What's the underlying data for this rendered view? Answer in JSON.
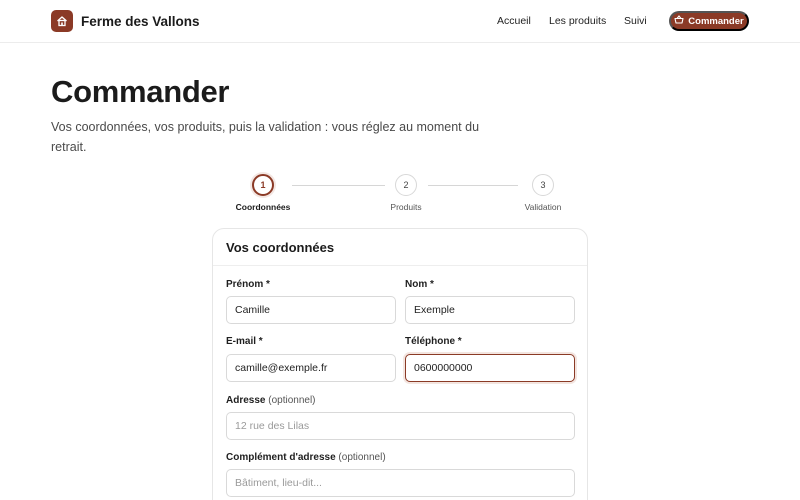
{
  "header": {
    "brand_name": "Ferme des Vallons",
    "nav": [
      "Accueil",
      "Les produits",
      "Suivi"
    ],
    "cta_label": "Commander"
  },
  "page": {
    "title": "Commander",
    "subtitle": "Vos coordonnées, vos produits, puis la validation : vous réglez au moment du retrait."
  },
  "stepper": {
    "steps": [
      {
        "number": "1",
        "label": "Coordonnées",
        "active": true
      },
      {
        "number": "2",
        "label": "Produits",
        "active": false
      },
      {
        "number": "3",
        "label": "Validation",
        "active": false
      }
    ]
  },
  "form": {
    "title": "Vos coordonnées",
    "prenom": {
      "label": "Prénom *",
      "value": "Camille"
    },
    "nom": {
      "label": "Nom *",
      "value": "Exemple"
    },
    "email": {
      "label": "E-mail *",
      "value": "camille@exemple.fr"
    },
    "telephone": {
      "label": "Téléphone *",
      "value": "0600000000"
    },
    "adresse": {
      "label": "Adresse",
      "optional": "(optionnel)",
      "placeholder": "12 rue des Lilas"
    },
    "complement": {
      "label": "Complément d'adresse",
      "optional": "(optionnel)",
      "placeholder": "Bâtiment, lieu-dit..."
    }
  },
  "colors": {
    "accent": "#8b3a26",
    "text": "#1b1b1b",
    "border": "#d9d9d9"
  },
  "icons": {
    "brand": "house-icon",
    "cta": "basket-icon"
  }
}
